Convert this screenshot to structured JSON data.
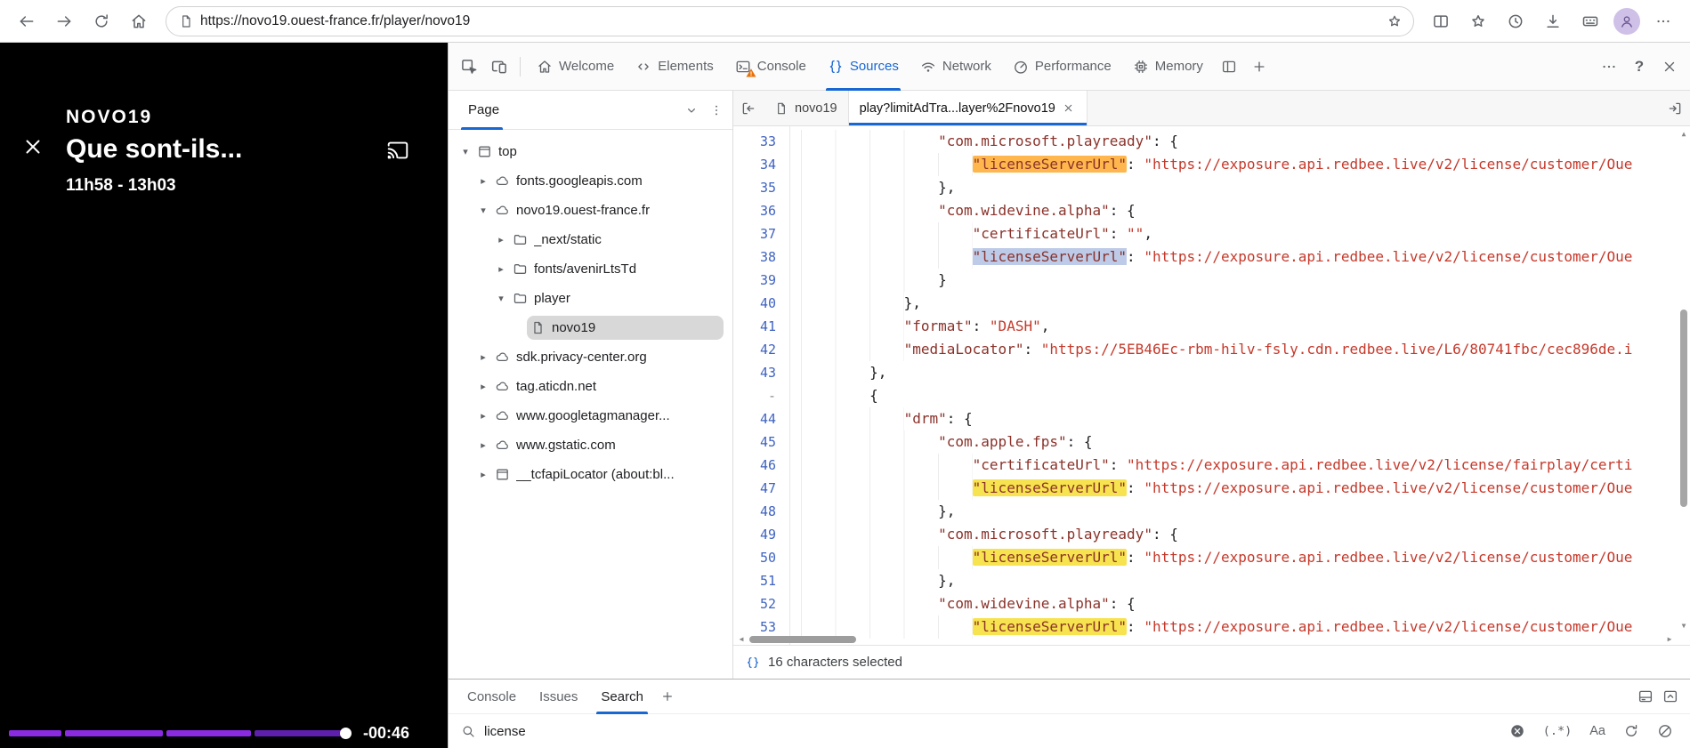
{
  "browser": {
    "url": "https://novo19.ouest-france.fr/player/novo19"
  },
  "player": {
    "brand": "NOVO19",
    "title": "Que sont-ils...",
    "schedule": "11h58 - 13h03",
    "remaining": "-00:46"
  },
  "colors": {
    "accent": "#1967d2",
    "warning": "#e8710a",
    "match_highlight": "#f7e24f",
    "active_match_highlight": "#ffb74d",
    "selection_highlight": "#bdcbe8",
    "progress": "#8a2be2"
  },
  "icons_glyphs": {
    "tree_expanded": "▾",
    "tree_collapsed": "▸",
    "scroll_up": "▲",
    "scroll_down": "▼",
    "scroll_left": "◀",
    "scroll_right": "▶"
  },
  "devtools": {
    "main_tabs": [
      {
        "label": "Welcome",
        "icon": "home"
      },
      {
        "label": "Elements",
        "icon": "elements"
      },
      {
        "label": "Console",
        "icon": "consoleic",
        "warning": true
      },
      {
        "label": "Sources",
        "icon": "sources",
        "active": true
      },
      {
        "label": "Network",
        "icon": "network"
      },
      {
        "label": "Performance",
        "icon": "performance"
      },
      {
        "label": "Memory",
        "icon": "memory"
      }
    ],
    "navigator": {
      "header": "Page",
      "tree": [
        {
          "label": "top",
          "icon": "frame",
          "arrow": "open",
          "depth": 0
        },
        {
          "label": "fonts.googleapis.com",
          "icon": "cloud",
          "arrow": "closed",
          "depth": 1
        },
        {
          "label": "novo19.ouest-france.fr",
          "icon": "cloud",
          "arrow": "open",
          "depth": 1
        },
        {
          "label": "_next/static",
          "icon": "folder",
          "arrow": "closed",
          "depth": 2
        },
        {
          "label": "fonts/avenirLtsTd",
          "icon": "folder",
          "arrow": "closed",
          "depth": 2
        },
        {
          "label": "player",
          "icon": "folder",
          "arrow": "open",
          "depth": 2
        },
        {
          "label": "novo19",
          "icon": "file",
          "arrow": "none",
          "depth": 3,
          "selected": true
        },
        {
          "label": "sdk.privacy-center.org",
          "icon": "cloud",
          "arrow": "closed",
          "depth": 1
        },
        {
          "label": "tag.aticdn.net",
          "icon": "cloud",
          "arrow": "closed",
          "depth": 1
        },
        {
          "label": "www.googletagmanager...",
          "icon": "cloud",
          "arrow": "closed",
          "depth": 1
        },
        {
          "label": "www.gstatic.com",
          "icon": "cloud",
          "arrow": "closed",
          "depth": 1
        },
        {
          "label": "__tcfapiLocator (about:bl...",
          "icon": "frame",
          "arrow": "closed",
          "depth": 1
        }
      ]
    },
    "editor": {
      "tabs": [
        {
          "label": "novo19",
          "icon": "file"
        },
        {
          "label": "play?limitAdTra...layer%2Fnovo19",
          "active": true,
          "closable": true
        }
      ],
      "status": "16 characters selected",
      "lines": [
        {
          "n": "33",
          "parts": [
            {
              "c": "ind",
              "t": "                "
            },
            {
              "c": "key",
              "t": "\"com.microsoft.playready\""
            },
            {
              "c": "pun",
              "t": ": {"
            }
          ]
        },
        {
          "n": "34",
          "parts": [
            {
              "c": "ind",
              "t": "                    "
            },
            {
              "c": "ma",
              "t": "\"licenseServerUrl\""
            },
            {
              "c": "pun",
              "t": ": "
            },
            {
              "c": "val",
              "t": "\"https://exposure.api.redbee.live/v2/license/customer/Oue"
            }
          ]
        },
        {
          "n": "35",
          "parts": [
            {
              "c": "ind",
              "t": "                "
            },
            {
              "c": "pun",
              "t": "},"
            }
          ]
        },
        {
          "n": "36",
          "parts": [
            {
              "c": "ind",
              "t": "                "
            },
            {
              "c": "key",
              "t": "\"com.widevine.alpha\""
            },
            {
              "c": "pun",
              "t": ": {"
            }
          ]
        },
        {
          "n": "37",
          "parts": [
            {
              "c": "ind",
              "t": "                    "
            },
            {
              "c": "key",
              "t": "\"certificateUrl\""
            },
            {
              "c": "pun",
              "t": ": "
            },
            {
              "c": "val",
              "t": "\"\""
            },
            {
              "c": "pun",
              "t": ","
            }
          ]
        },
        {
          "n": "38",
          "parts": [
            {
              "c": "ind",
              "t": "                    "
            },
            {
              "c": "sel",
              "t": "\"licenseServerUrl\""
            },
            {
              "c": "pun",
              "t": ": "
            },
            {
              "c": "val",
              "t": "\"https://exposure.api.redbee.live/v2/license/customer/Oue"
            }
          ]
        },
        {
          "n": "39",
          "parts": [
            {
              "c": "ind",
              "t": "                "
            },
            {
              "c": "pun",
              "t": "}"
            }
          ]
        },
        {
          "n": "40",
          "parts": [
            {
              "c": "ind",
              "t": "            "
            },
            {
              "c": "pun",
              "t": "},"
            }
          ]
        },
        {
          "n": "41",
          "parts": [
            {
              "c": "ind",
              "t": "            "
            },
            {
              "c": "key",
              "t": "\"format\""
            },
            {
              "c": "pun",
              "t": ": "
            },
            {
              "c": "val",
              "t": "\"DASH\""
            },
            {
              "c": "pun",
              "t": ","
            }
          ]
        },
        {
          "n": "42",
          "parts": [
            {
              "c": "ind",
              "t": "            "
            },
            {
              "c": "key",
              "t": "\"mediaLocator\""
            },
            {
              "c": "pun",
              "t": ": "
            },
            {
              "c": "val",
              "t": "\"https://5EB46Ec-rbm-hilv-fsly.cdn.redbee.live/L6/80741fbc/cec896de.i"
            }
          ]
        },
        {
          "n": "43",
          "parts": [
            {
              "c": "ind",
              "t": "        "
            },
            {
              "c": "pun",
              "t": "},"
            }
          ]
        },
        {
          "n": "-",
          "parts": [
            {
              "c": "ind",
              "t": "        "
            },
            {
              "c": "pun",
              "t": "{"
            }
          ]
        },
        {
          "n": "44",
          "parts": [
            {
              "c": "ind",
              "t": "            "
            },
            {
              "c": "key",
              "t": "\"drm\""
            },
            {
              "c": "pun",
              "t": ": {"
            }
          ]
        },
        {
          "n": "45",
          "parts": [
            {
              "c": "ind",
              "t": "                "
            },
            {
              "c": "key",
              "t": "\"com.apple.fps\""
            },
            {
              "c": "pun",
              "t": ": {"
            }
          ]
        },
        {
          "n": "46",
          "parts": [
            {
              "c": "ind",
              "t": "                    "
            },
            {
              "c": "key",
              "t": "\"certificateUrl\""
            },
            {
              "c": "pun",
              "t": ": "
            },
            {
              "c": "val",
              "t": "\"https://exposure.api.redbee.live/v2/license/fairplay/certi"
            }
          ]
        },
        {
          "n": "47",
          "parts": [
            {
              "c": "ind",
              "t": "                    "
            },
            {
              "c": "m",
              "t": "\"licenseServerUrl\""
            },
            {
              "c": "pun",
              "t": ": "
            },
            {
              "c": "val",
              "t": "\"https://exposure.api.redbee.live/v2/license/customer/Oue"
            }
          ]
        },
        {
          "n": "48",
          "parts": [
            {
              "c": "ind",
              "t": "                "
            },
            {
              "c": "pun",
              "t": "},"
            }
          ]
        },
        {
          "n": "49",
          "parts": [
            {
              "c": "ind",
              "t": "                "
            },
            {
              "c": "key",
              "t": "\"com.microsoft.playready\""
            },
            {
              "c": "pun",
              "t": ": {"
            }
          ]
        },
        {
          "n": "50",
          "parts": [
            {
              "c": "ind",
              "t": "                    "
            },
            {
              "c": "m",
              "t": "\"licenseServerUrl\""
            },
            {
              "c": "pun",
              "t": ": "
            },
            {
              "c": "val",
              "t": "\"https://exposure.api.redbee.live/v2/license/customer/Oue"
            }
          ]
        },
        {
          "n": "51",
          "parts": [
            {
              "c": "ind",
              "t": "                "
            },
            {
              "c": "pun",
              "t": "},"
            }
          ]
        },
        {
          "n": "52",
          "parts": [
            {
              "c": "ind",
              "t": "                "
            },
            {
              "c": "key",
              "t": "\"com.widevine.alpha\""
            },
            {
              "c": "pun",
              "t": ": {"
            }
          ]
        },
        {
          "n": "53",
          "parts": [
            {
              "c": "ind",
              "t": "                    "
            },
            {
              "c": "m",
              "t": "\"licenseServerUrl\""
            },
            {
              "c": "pun",
              "t": ": "
            },
            {
              "c": "val",
              "t": "\"https://exposure.api.redbee.live/v2/license/customer/Oue"
            }
          ]
        }
      ]
    },
    "drawer": {
      "tabs": [
        {
          "label": "Console"
        },
        {
          "label": "Issues"
        },
        {
          "label": "Search",
          "active": true
        }
      ],
      "search_value": "license",
      "regex_label": "(.*)",
      "match_case_label": "Aa"
    }
  }
}
